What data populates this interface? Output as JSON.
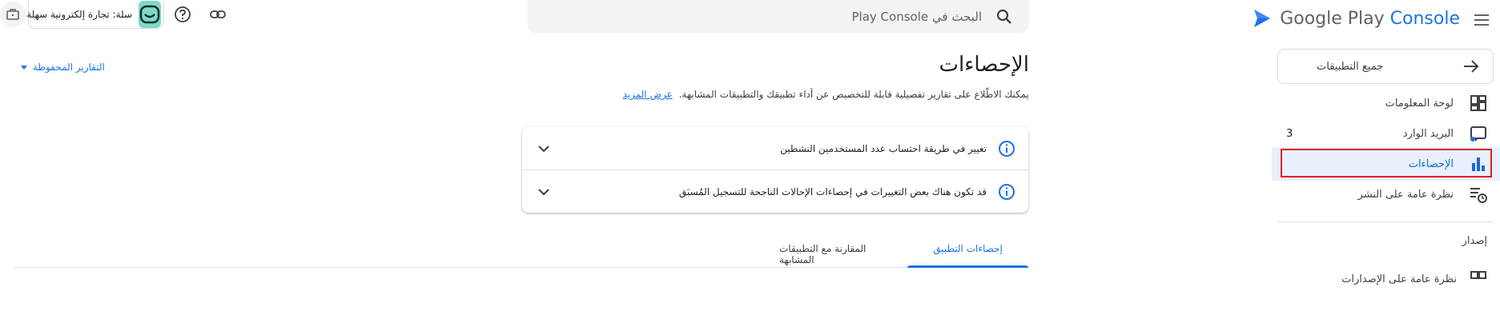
{
  "brand": {
    "name_prefix": "Google Play",
    "name_accent": "Console"
  },
  "sidebar": {
    "all_apps_label": "جميع التطبيقات",
    "items": [
      {
        "label": "لوحة المعلومات",
        "icon": "dashboard-icon"
      },
      {
        "label": "البريد الوارد",
        "icon": "inbox-icon",
        "badge": "3"
      },
      {
        "label": "الإحصاءات",
        "icon": "bar-chart-icon",
        "active": true
      },
      {
        "label": "نظرة عامة على النشر",
        "icon": "publishing-overview-icon"
      }
    ],
    "section_release": "إصدار",
    "partial_item_label": "نظرة عامة على الإصدارات"
  },
  "search": {
    "placeholder": "البحث في Play Console"
  },
  "app": {
    "name": "سلة: تجارة إلكترونية سهلة"
  },
  "main": {
    "title": "الإحصاءات",
    "subtitle": "يمكنك الاطّلاع على تقارير تفصيلية قابلة للتخصيص عن أداء تطبيقك والتطبيقات المشابهة.",
    "learn_more": "عرض المزيد",
    "saved_reports": "التقارير المحفوظة",
    "notices": [
      {
        "text": "تغيير في طريقة احتساب عدد المستخدمين النشطين"
      },
      {
        "text": "قد تكون هناك بعض التغييرات في إحصاءات الإحالات الناجحة للتسجيل المُسبَق"
      }
    ],
    "tabs": [
      {
        "label": "إحصاءات التطبيق",
        "active": true
      },
      {
        "label": "المقارنة مع التطبيقات المشابهة",
        "active": false
      }
    ]
  },
  "colors": {
    "accent": "#1a73e8",
    "active_bg": "#e8f0fe",
    "highlight": "#e0201e",
    "app_logo_bg": "#7ed9c3"
  }
}
